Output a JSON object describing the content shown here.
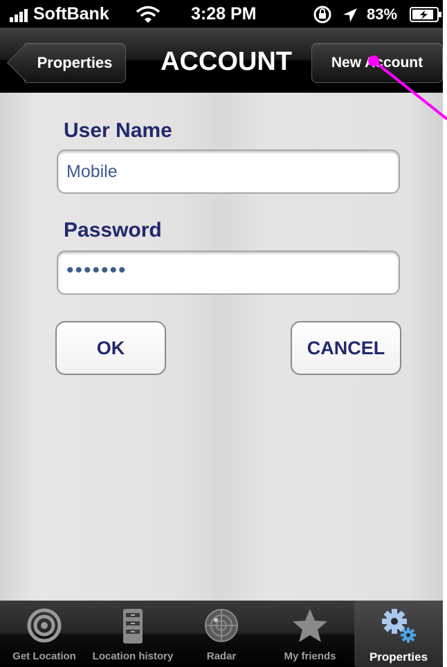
{
  "status_bar": {
    "carrier": "SoftBank",
    "time": "3:28 PM",
    "battery": "83%"
  },
  "nav": {
    "back_label": "Properties",
    "title": "ACCOUNT",
    "right_label": "New Account"
  },
  "form": {
    "username_label": "User Name",
    "username_value": "Mobile",
    "password_label": "Password",
    "password_value": "•••••••",
    "ok_label": "OK",
    "cancel_label": "CANCEL"
  },
  "tabs": [
    {
      "label": "Get Location",
      "icon": "target-icon"
    },
    {
      "label": "Location history",
      "icon": "cabinet-icon"
    },
    {
      "label": "Radar",
      "icon": "radar-icon"
    },
    {
      "label": "My friends",
      "icon": "star-icon"
    },
    {
      "label": "Properties",
      "icon": "gear-icon",
      "active": true
    }
  ],
  "colors": {
    "label": "#23286e",
    "field_text": "#3d5d8e",
    "annotation": "#ff00ff"
  }
}
